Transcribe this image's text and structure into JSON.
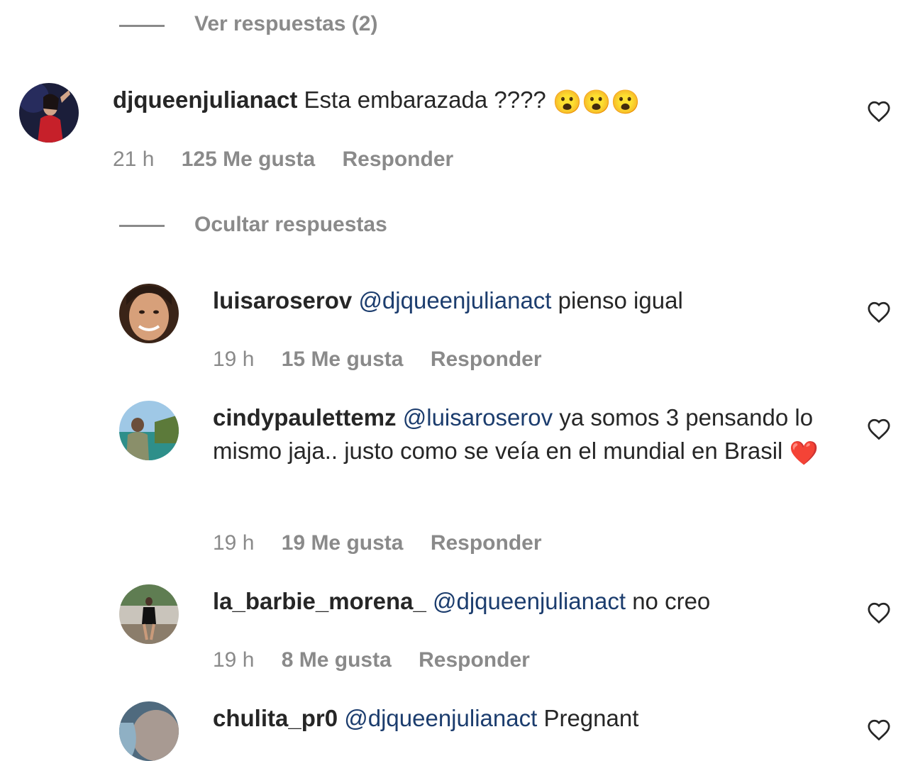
{
  "view_replies_1": {
    "label": "Ver respuestas (2)"
  },
  "comment_main": {
    "username": "djqueenjulianact",
    "text": "Esta embarazada ????",
    "emojis": [
      "😮",
      "😮",
      "😮"
    ],
    "time": "21 h",
    "likes": "125 Me gusta",
    "reply": "Responder"
  },
  "hide_replies": {
    "label": "Ocultar respuestas"
  },
  "replies": [
    {
      "username": "luisaroserov",
      "mention": "@djqueenjulianact",
      "text": "pienso igual",
      "time": "19 h",
      "likes": "15 Me gusta",
      "reply": "Responder"
    },
    {
      "username": "cindypaulettemz",
      "mention": "@luisaroserov",
      "text": "ya somos 3 pensando lo mismo jaja.. justo como se veía en el mundial en Brasil",
      "emoji": "❤️",
      "time": "19 h",
      "likes": "19 Me gusta",
      "reply": "Responder"
    },
    {
      "username": "la_barbie_morena_",
      "mention": "@djqueenjulianact",
      "text": "no creo",
      "time": "19 h",
      "likes": "8 Me gusta",
      "reply": "Responder"
    },
    {
      "username": "chulita_pr0",
      "mention": "@djqueenjulianact",
      "text": "Pregnant"
    }
  ]
}
